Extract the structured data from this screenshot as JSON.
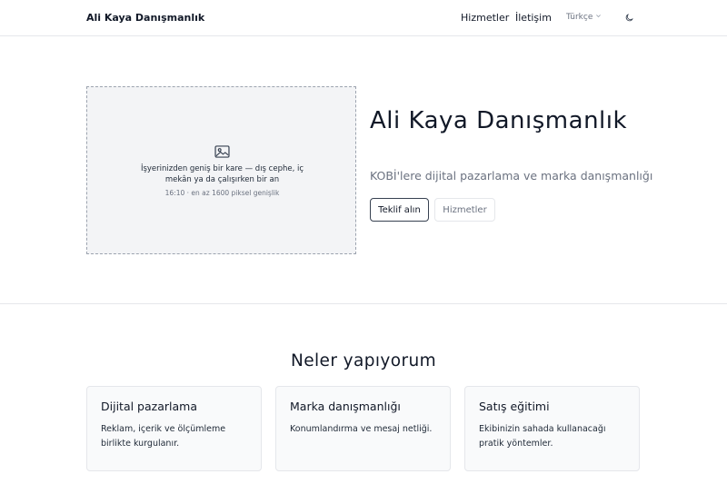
{
  "header": {
    "brand": "Ali Kaya Danışmanlık",
    "nav": {
      "services": "Hizmetler",
      "contact": "İletişim"
    },
    "language": "Türkçe",
    "icons": {
      "language_caret": "chevron-down-icon",
      "theme": "moon-icon"
    }
  },
  "hero": {
    "image_placeholder": {
      "icon": "image-icon",
      "caption": "İşyerinizden geniş bir kare — dış cephe, iç mekân ya da çalışırken bir an",
      "hint": "16:10 · en az 1600 piksel genişlik"
    },
    "title": "Ali Kaya Danışmanlık",
    "subtitle": "KOBİ'lere dijital pazarlama ve marka danışmanlığı",
    "primary_button": "Teklif alın",
    "secondary_button": "Hizmetler"
  },
  "services": {
    "title": "Neler yapıyorum",
    "items": [
      {
        "title": "Dijital pazarlama",
        "text": "Reklam, içerik ve ölçümleme birlikte kurgulanır."
      },
      {
        "title": "Marka danışmanlığı",
        "text": "Konumlandırma ve mesaj netliği."
      },
      {
        "title": "Satış eğitimi",
        "text": "Ekibinizin sahada kullanacağı pratik yöntemler."
      }
    ]
  },
  "colors": {
    "text": "#111827",
    "muted": "#6b7280",
    "border": "#e5e7eb",
    "placeholder_bg": "#f3f4f6",
    "card_bg": "#f9fafb"
  }
}
